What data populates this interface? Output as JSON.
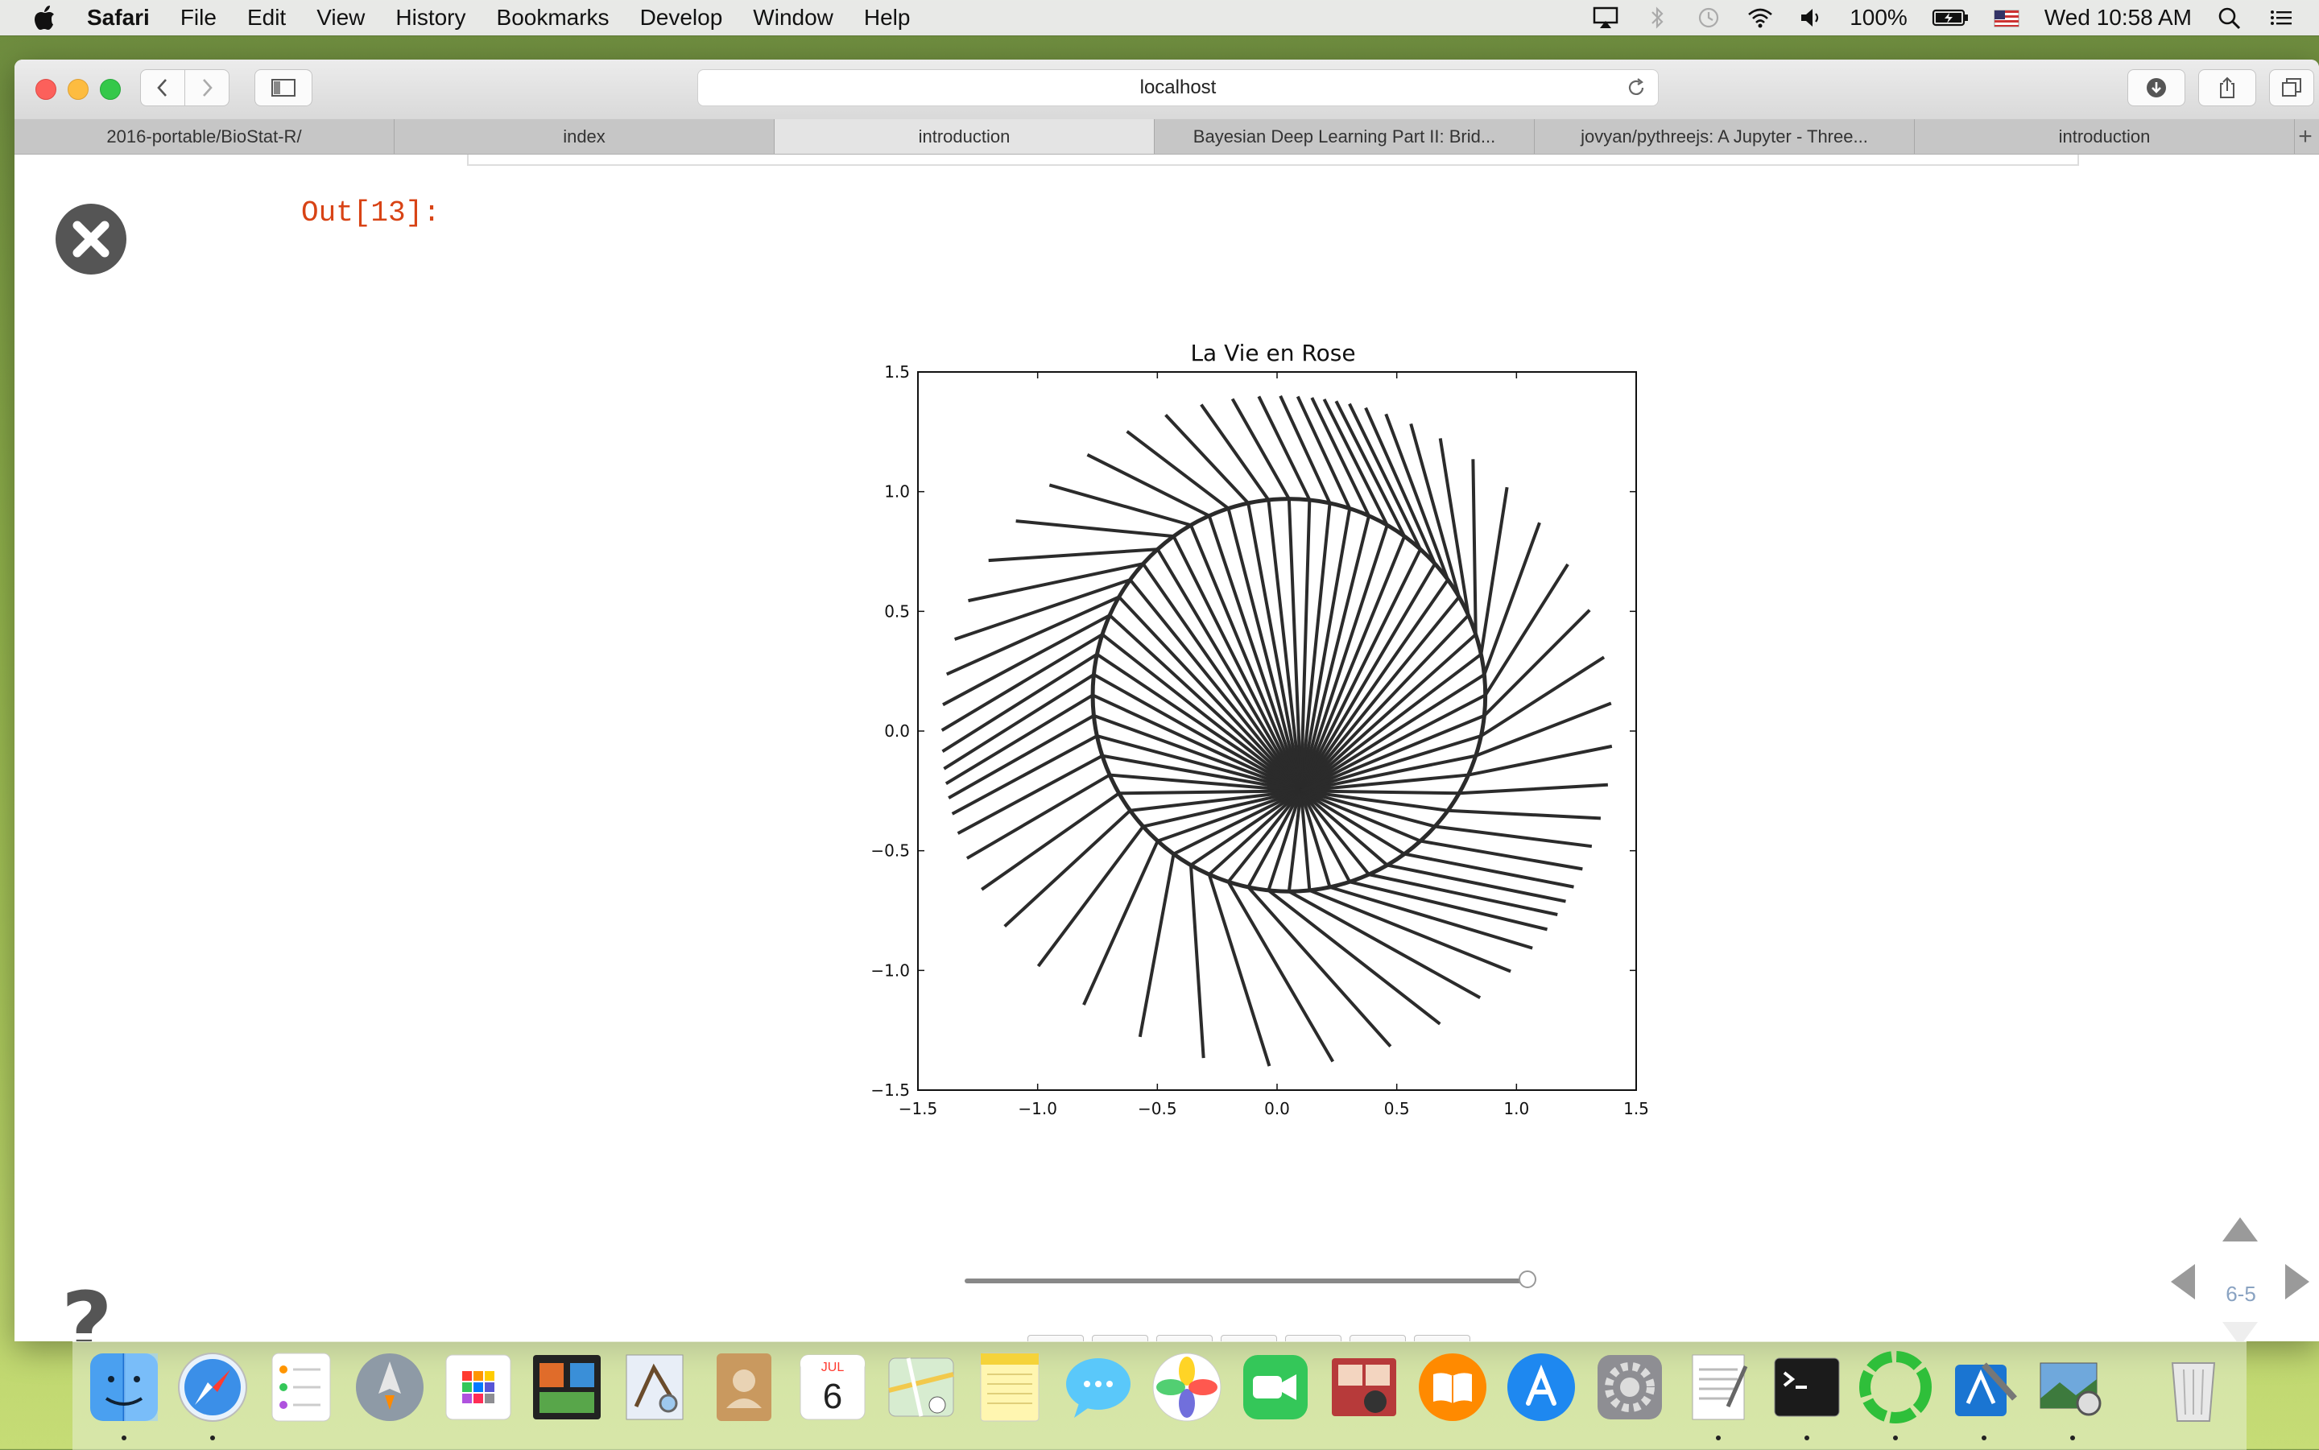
{
  "menubar": {
    "app_name": "Safari",
    "menus": [
      "File",
      "Edit",
      "View",
      "History",
      "Bookmarks",
      "Develop",
      "Window",
      "Help"
    ],
    "battery": "100%",
    "clock": "Wed 10:58 AM"
  },
  "browser": {
    "address": "localhost",
    "tabs": [
      {
        "label": "2016-portable/BioStat-R/",
        "active": false
      },
      {
        "label": "index",
        "active": false
      },
      {
        "label": "introduction",
        "active": true
      },
      {
        "label": "Bayesian Deep Learning Part II: Brid...",
        "active": false
      },
      {
        "label": "jovyan/pythreejs: A Jupyter - Three...",
        "active": false
      },
      {
        "label": "introduction",
        "active": false
      }
    ]
  },
  "notebook": {
    "out_prompt": "Out[13]:",
    "help_symbol": "?",
    "slide_number": "6-5",
    "animation_buttons": [
      "first",
      "previous-frame",
      "play-reverse",
      "pause",
      "play",
      "next-frame",
      "last"
    ],
    "slider_value": 1.0
  },
  "chart_data": {
    "type": "line",
    "title": "La Vie en Rose",
    "xlabel": "",
    "ylabel": "",
    "xlim": [
      -1.5,
      1.5
    ],
    "ylim": [
      -1.5,
      1.5
    ],
    "xticks": [
      "−1.5",
      "−1.0",
      "−0.5",
      "0.0",
      "0.5",
      "1.0",
      "1.5"
    ],
    "yticks": [
      "−1.5",
      "−1.0",
      "−0.5",
      "0.0",
      "0.5",
      "1.0",
      "1.5"
    ],
    "grid": false,
    "color": "#2b2b2b",
    "series": [
      {
        "description": "chords of an inner circle (center ~0.05,0.15, r ~0.82) through pivot (0.1,-0.25), extended outward",
        "inner_circle": {
          "cx": 0.05,
          "cy": 0.15,
          "r": 0.82
        },
        "pivot": [
          0.1,
          -0.25
        ],
        "outer_radius": 1.4,
        "n_lines": 60
      }
    ]
  },
  "dock": {
    "apps": [
      "finder-icon",
      "safari-icon",
      "reminders-icon",
      "launchpad-icon",
      "dashboard-icon",
      "photo-booth-icon",
      "preview-icon",
      "contacts-icon",
      "calendar-icon",
      "maps-icon",
      "notes-icon",
      "messages-icon",
      "photos-icon",
      "facetime-icon",
      "photo-slideshow-icon",
      "ibooks-icon",
      "app-store-icon",
      "system-preferences-icon",
      "textedit-icon",
      "terminal-icon",
      "activity-icon",
      "xcode-icon",
      "image-capture-icon",
      "trash-icon"
    ],
    "calendar_month": "JUL",
    "calendar_day": "6"
  }
}
